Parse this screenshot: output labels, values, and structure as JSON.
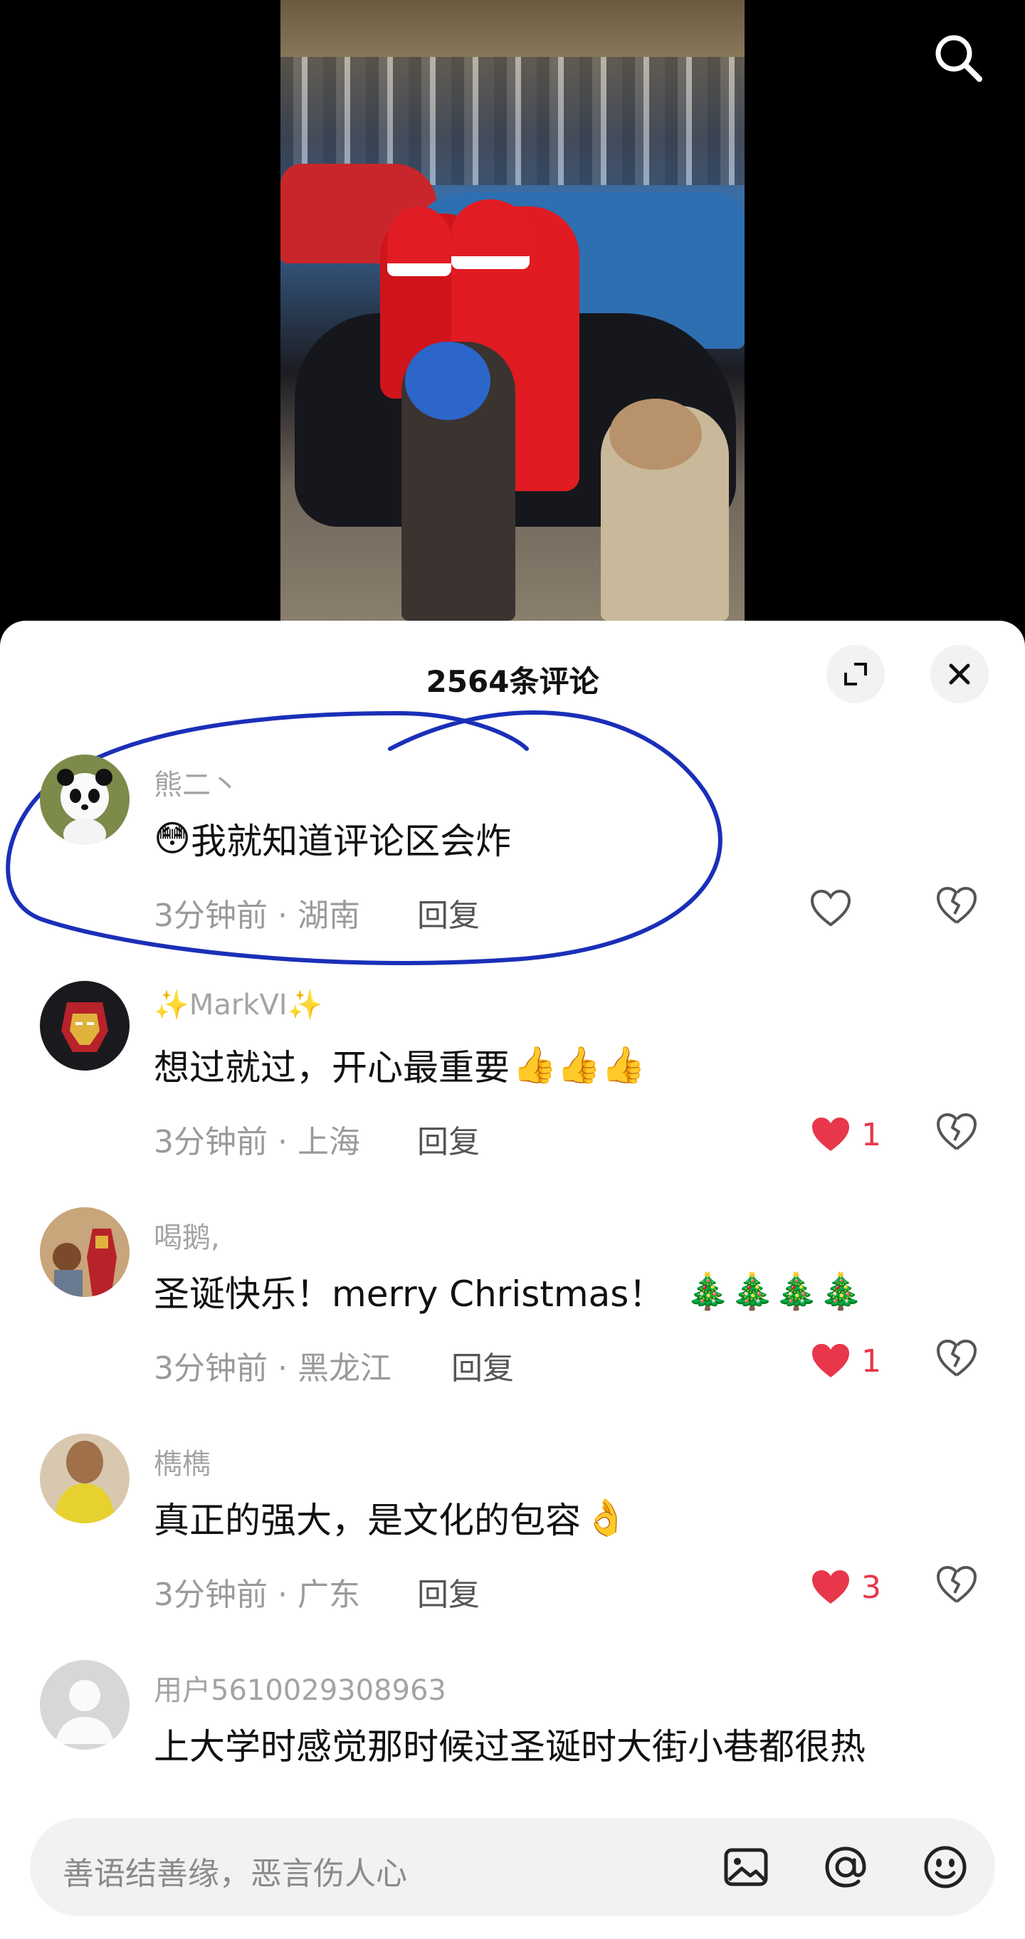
{
  "video": {
    "description_icon": "video-player"
  },
  "header": {
    "search_icon": "search-icon"
  },
  "comments_panel": {
    "title": "2564条评论",
    "expand_icon": "expand-icon",
    "close_icon": "close-icon"
  },
  "comments": [
    {
      "username": "熊二丶",
      "text": "我就知道评论区会炸",
      "prefix_emoji": "😳",
      "suffix_emoji": "",
      "time": "3分钟前",
      "location": "湖南",
      "reply_label": "回复",
      "likes": "",
      "liked": false
    },
    {
      "username": "✨MarkVI✨",
      "text": "想过就过，开心最重要",
      "prefix_emoji": "",
      "suffix_emoji": "👍👍👍",
      "time": "3分钟前",
      "location": "上海",
      "reply_label": "回复",
      "likes": "1",
      "liked": true
    },
    {
      "username": "喝鹅,",
      "text": "圣诞快乐！merry Christmas！",
      "prefix_emoji": "",
      "suffix_emoji": "🎄🎄🎄🎄",
      "time": "3分钟前",
      "location": "黑龙江",
      "reply_label": "回复",
      "likes": "1",
      "liked": true
    },
    {
      "username": "檇檇",
      "text": "真正的强大，是文化的包容",
      "prefix_emoji": "",
      "suffix_emoji": "👌",
      "time": "3分钟前",
      "location": "广东",
      "reply_label": "回复",
      "likes": "3",
      "liked": true
    },
    {
      "username": "用户5610029308963",
      "text": "上大学时感觉那时候过圣诞时大街小巷都很热",
      "prefix_emoji": "",
      "suffix_emoji": "",
      "time": "",
      "location": "",
      "reply_label": "",
      "likes": "",
      "liked": false
    }
  ],
  "meta_separator": " · ",
  "input_bar": {
    "placeholder": "善语结善缘，恶言伤人心",
    "icons": [
      "image-icon",
      "at-icon",
      "emoji-icon"
    ]
  },
  "colors": {
    "like_red": "#e8364a",
    "doodle_blue": "#1a2fb8",
    "sheet_bg": "#ffffff"
  }
}
